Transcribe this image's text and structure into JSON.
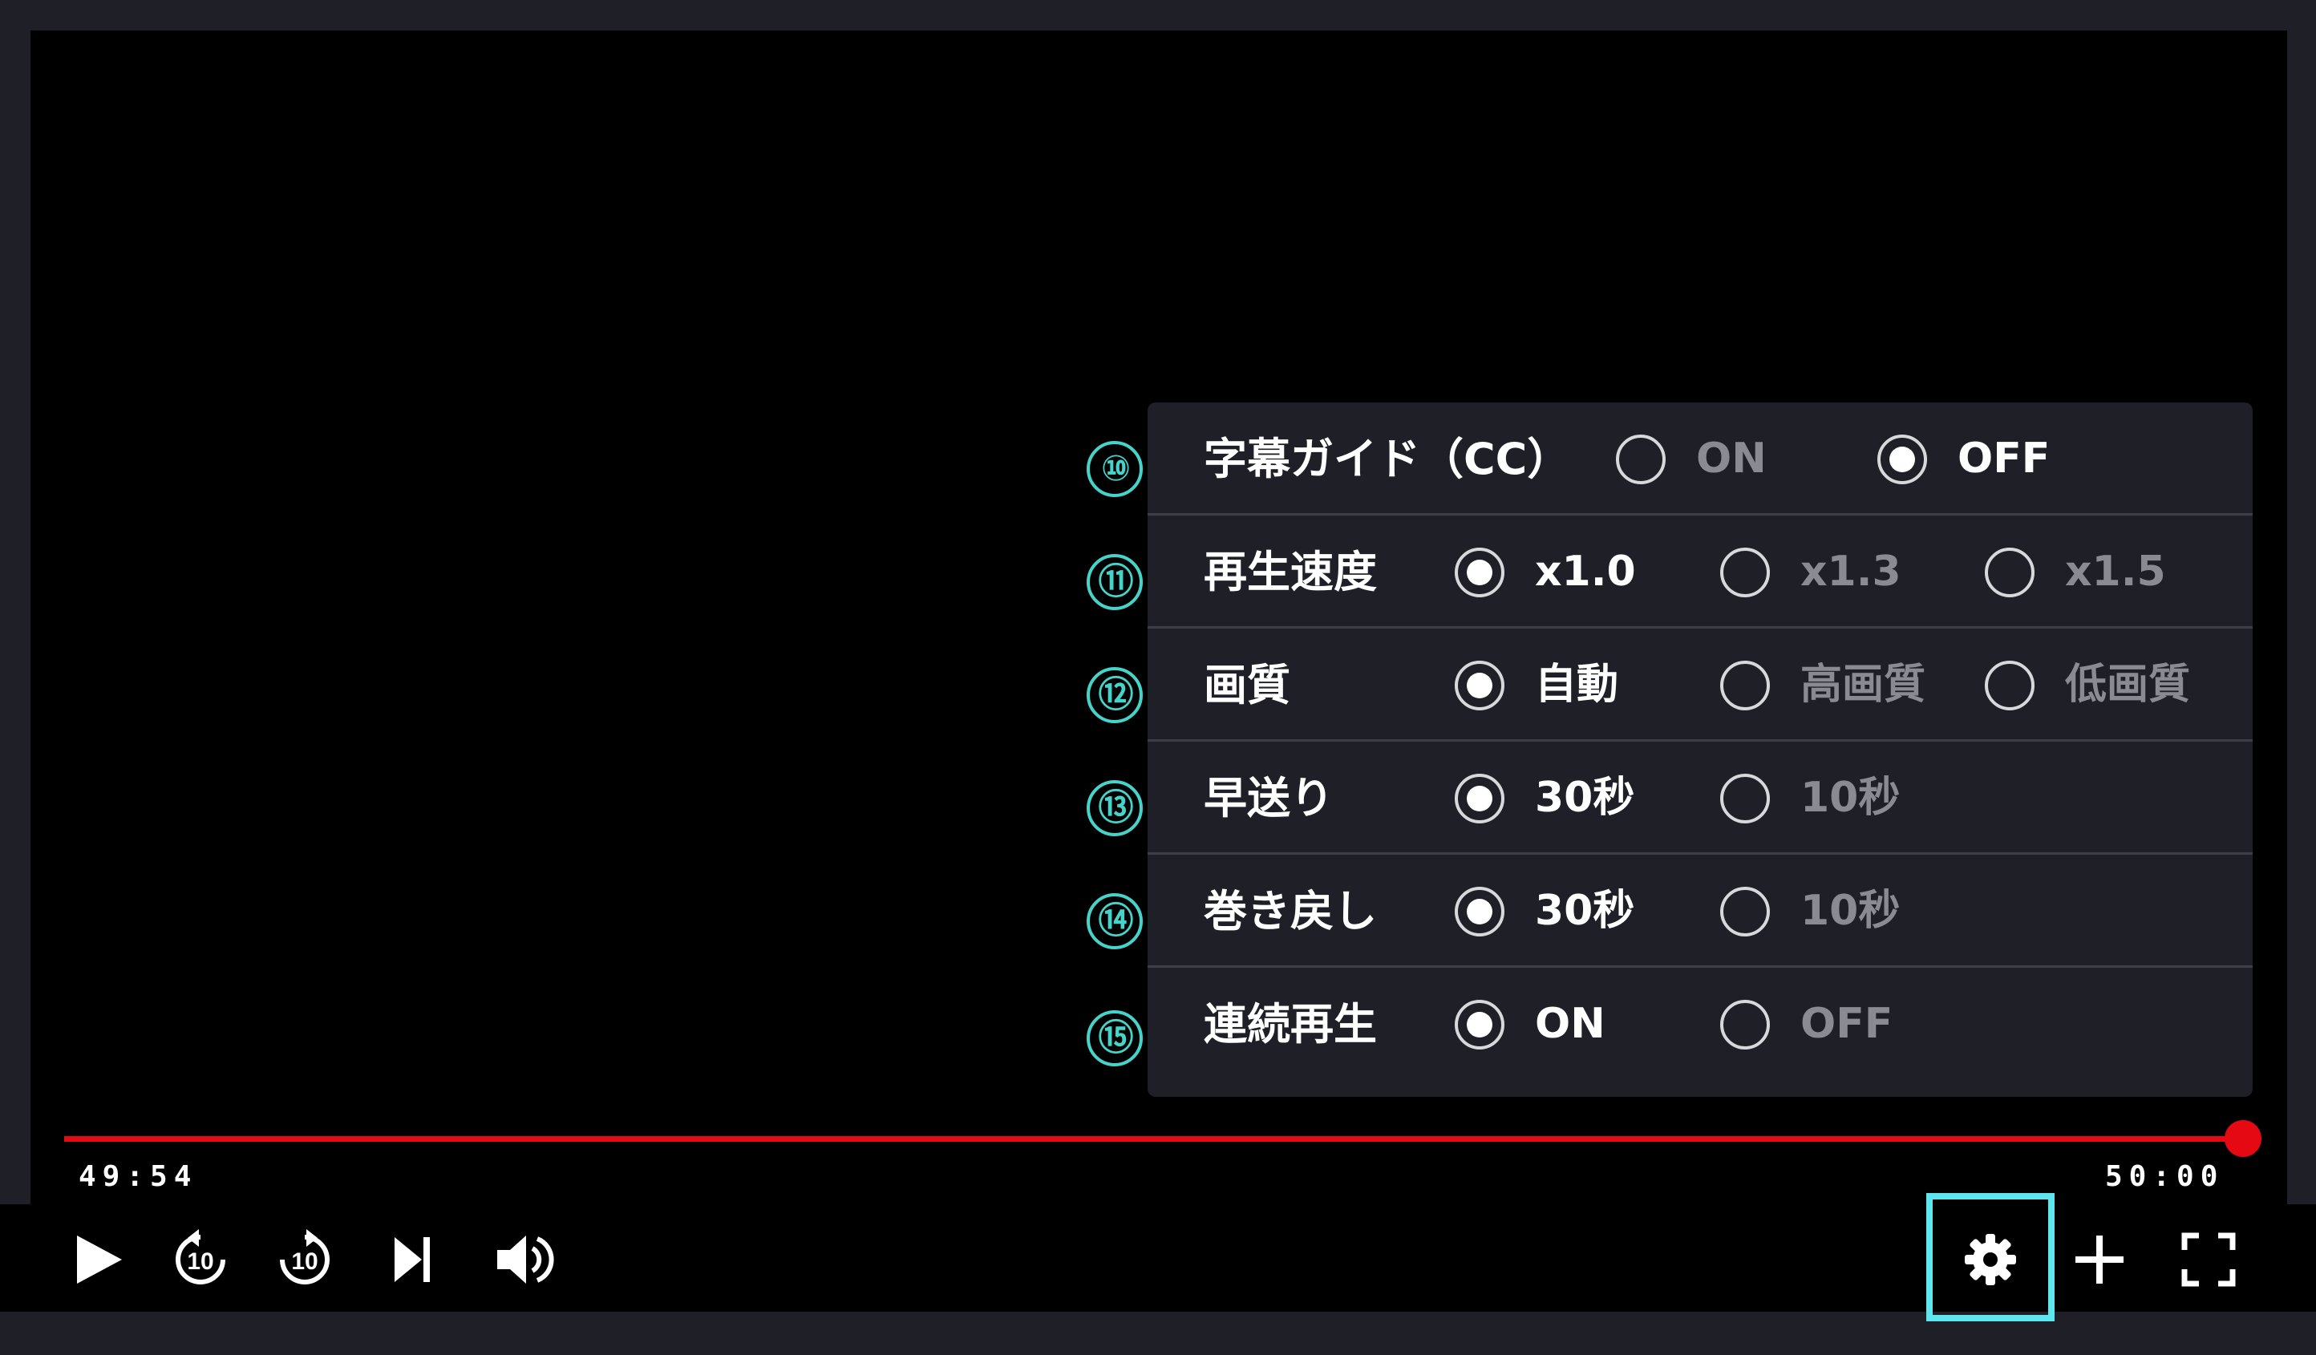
{
  "settings": {
    "rows": [
      {
        "number": "⑩",
        "label": "字幕ガイド（CC）",
        "options": [
          {
            "label": "ON",
            "selected": false
          },
          {
            "label": "OFF",
            "selected": true
          }
        ]
      },
      {
        "number": "⑪",
        "label": "再生速度",
        "options": [
          {
            "label": "x1.0",
            "selected": true
          },
          {
            "label": "x1.3",
            "selected": false
          },
          {
            "label": "x1.5",
            "selected": false
          }
        ]
      },
      {
        "number": "⑫",
        "label": "画質",
        "options": [
          {
            "label": "自動",
            "selected": true
          },
          {
            "label": "高画質",
            "selected": false
          },
          {
            "label": "低画質",
            "selected": false
          }
        ]
      },
      {
        "number": "⑬",
        "label": "早送り",
        "options": [
          {
            "label": "30秒",
            "selected": true
          },
          {
            "label": "10秒",
            "selected": false
          }
        ]
      },
      {
        "number": "⑭",
        "label": "巻き戻し",
        "options": [
          {
            "label": "30秒",
            "selected": true
          },
          {
            "label": "10秒",
            "selected": false
          }
        ]
      },
      {
        "number": "⑮",
        "label": "連続再生",
        "options": [
          {
            "label": "ON",
            "selected": true
          },
          {
            "label": "OFF",
            "selected": false
          }
        ]
      }
    ]
  },
  "player": {
    "current_time": "49:54",
    "duration": "50:00",
    "progress": 0.998,
    "skip_seconds": "10"
  },
  "controls": {
    "left": [
      "play-icon",
      "rewind-10-icon",
      "forward-10-icon",
      "next-episode-icon",
      "volume-icon"
    ],
    "right": [
      "gear-icon",
      "plus-icon",
      "fullscreen-icon"
    ]
  },
  "colors": {
    "accent": "#e50914",
    "highlight": "#5ee6ee",
    "badge": "#46d3c9",
    "panel": "#1f2027"
  }
}
